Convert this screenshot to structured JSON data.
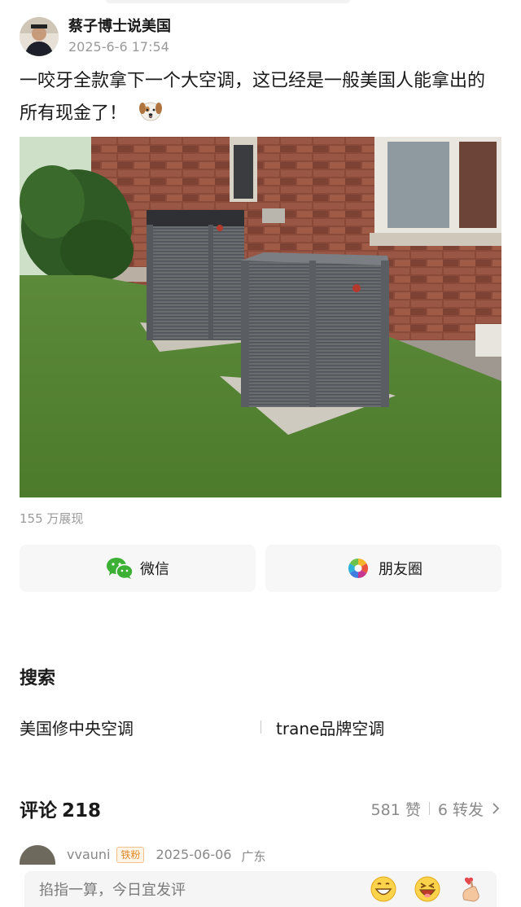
{
  "author": {
    "name": "蔡子博士说美国",
    "time": "2025-6-6 17:54"
  },
  "post": {
    "text": "一咬牙全款拿下一个大空调，这已经是一般美国人能拿出的所有现金了！",
    "emoji": "dog-face-emoji"
  },
  "views": "155 万展现",
  "share": {
    "wechat": "微信",
    "moments": "朋友圈"
  },
  "search": {
    "title": "搜索",
    "items": [
      "美国修中央空调",
      "trane品牌空调"
    ]
  },
  "comments": {
    "title": "评论",
    "count": "218",
    "likes": "581 赞",
    "reposts": "6 转发"
  },
  "comment_preview": {
    "user": "vvauni",
    "badge": "铁粉",
    "date": "2025-06-06",
    "location": "广东"
  },
  "input": {
    "placeholder": "掐指一算，今日宜发评"
  },
  "colors": {
    "wechat_green": "#3cb034",
    "badge_orange": "#e0892a",
    "muted_text": "#9a9a9a"
  }
}
